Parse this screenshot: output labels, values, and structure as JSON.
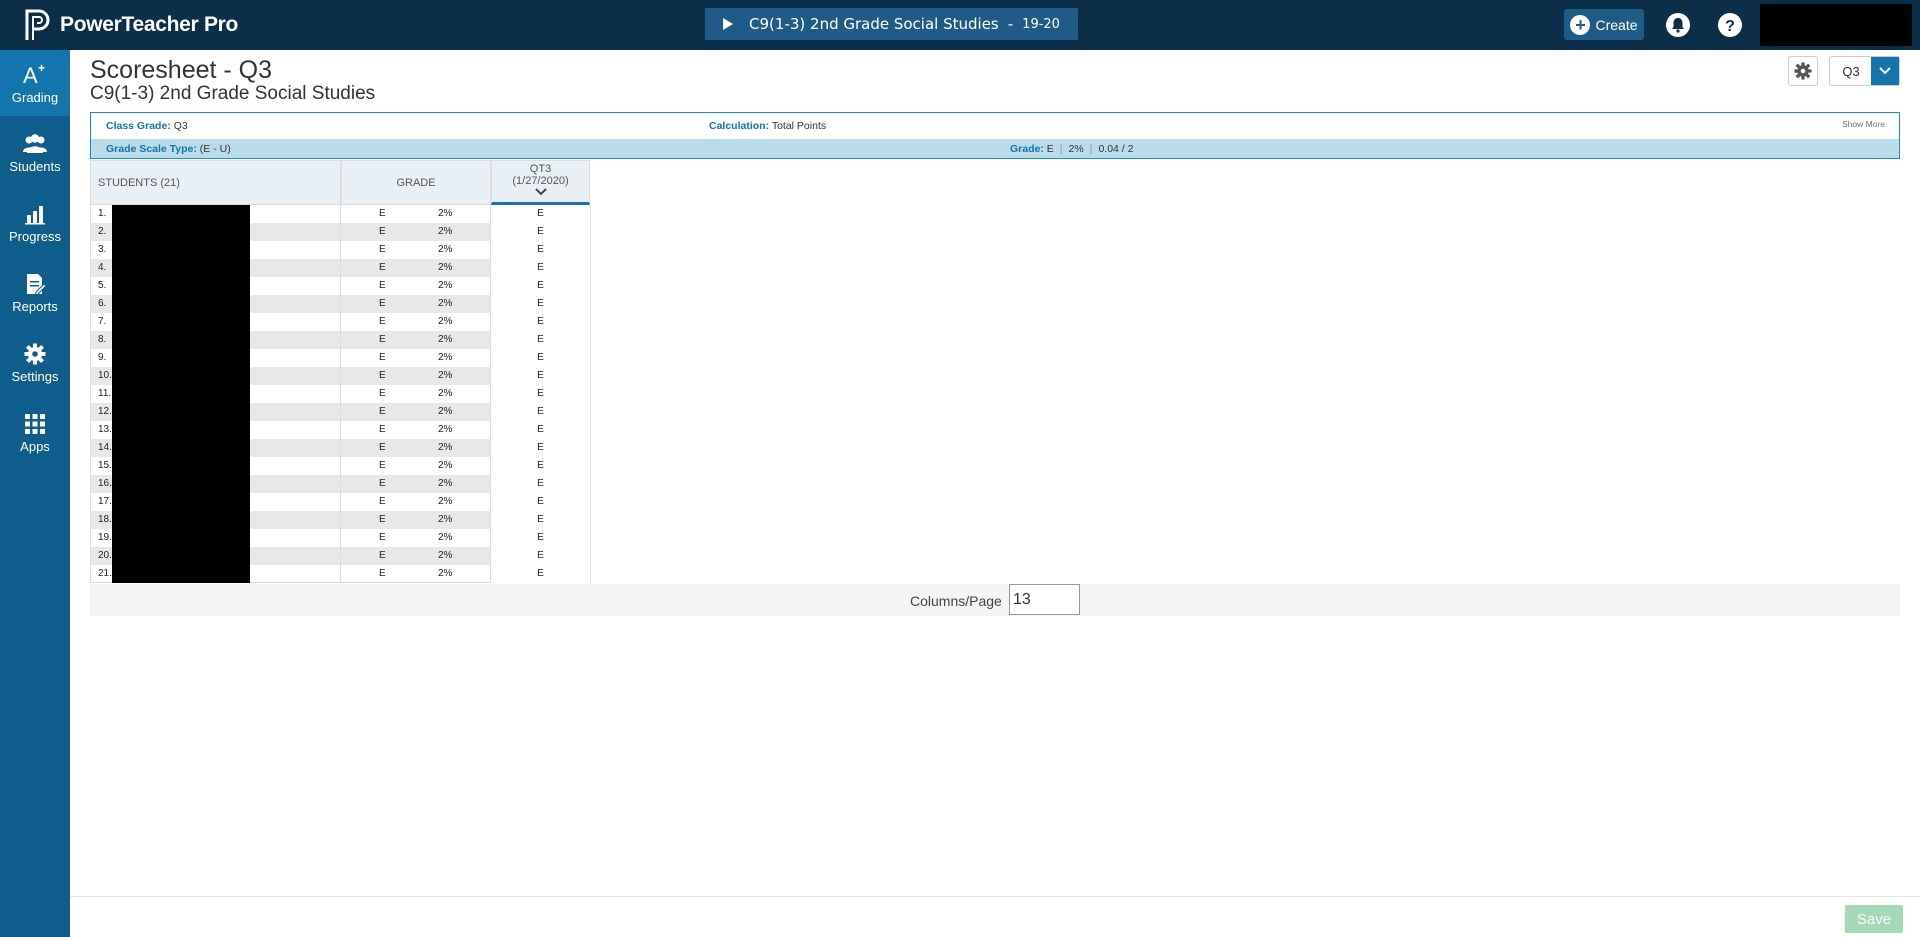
{
  "app": {
    "name": "PowerTeacher Pro"
  },
  "header": {
    "class_name": "C9(1-3) 2nd Grade Social Studies",
    "separator": "-",
    "year": "19-20",
    "create_label": "Create",
    "help_label": "?"
  },
  "nav": [
    {
      "label": "Grading",
      "icon": "grading-icon"
    },
    {
      "label": "Students",
      "icon": "students-icon"
    },
    {
      "label": "Progress",
      "icon": "progress-icon"
    },
    {
      "label": "Reports",
      "icon": "reports-icon"
    },
    {
      "label": "Settings",
      "icon": "settings-icon"
    },
    {
      "label": "Apps",
      "icon": "apps-icon"
    }
  ],
  "page": {
    "title": "Scoresheet - Q3",
    "subtitle": "C9(1-3) 2nd Grade Social Studies",
    "term": "Q3"
  },
  "info": {
    "class_grade_label": "Class Grade:",
    "class_grade_value": "Q3",
    "calculation_label": "Calculation:",
    "calculation_value": "Total Points",
    "show_more": "Show More",
    "grade_scale_label": "Grade Scale Type:",
    "grade_scale_value": "(E - U)",
    "grade_label": "Grade:",
    "grade_value": "E",
    "grade_percent": "2%",
    "grade_points": "0.04 / 2"
  },
  "table": {
    "students_header": "STUDENTS (21)",
    "grade_header": "GRADE",
    "assignment_name": "QT3",
    "assignment_date": "(1/27/2020)",
    "rows": [
      {
        "num": "1.",
        "grade": "E",
        "pct": "2%",
        "score": "E"
      },
      {
        "num": "2.",
        "grade": "E",
        "pct": "2%",
        "score": "E"
      },
      {
        "num": "3.",
        "grade": "E",
        "pct": "2%",
        "score": "E"
      },
      {
        "num": "4.",
        "grade": "E",
        "pct": "2%",
        "score": "E"
      },
      {
        "num": "5.",
        "grade": "E",
        "pct": "2%",
        "score": "E"
      },
      {
        "num": "6.",
        "grade": "E",
        "pct": "2%",
        "score": "E"
      },
      {
        "num": "7.",
        "grade": "E",
        "pct": "2%",
        "score": "E"
      },
      {
        "num": "8.",
        "grade": "E",
        "pct": "2%",
        "score": "E"
      },
      {
        "num": "9.",
        "grade": "E",
        "pct": "2%",
        "score": "E"
      },
      {
        "num": "10.",
        "grade": "E",
        "pct": "2%",
        "score": "E"
      },
      {
        "num": "11.",
        "grade": "E",
        "pct": "2%",
        "score": "E"
      },
      {
        "num": "12.",
        "grade": "E",
        "pct": "2%",
        "score": "E"
      },
      {
        "num": "13.",
        "grade": "E",
        "pct": "2%",
        "score": "E"
      },
      {
        "num": "14.",
        "grade": "E",
        "pct": "2%",
        "score": "E"
      },
      {
        "num": "15.",
        "grade": "E",
        "pct": "2%",
        "score": "E"
      },
      {
        "num": "16.",
        "grade": "E",
        "pct": "2%",
        "score": "E"
      },
      {
        "num": "17.",
        "grade": "E",
        "pct": "2%",
        "score": "E"
      },
      {
        "num": "18.",
        "grade": "E",
        "pct": "2%",
        "score": "E"
      },
      {
        "num": "19.",
        "grade": "E",
        "pct": "2%",
        "score": "E"
      },
      {
        "num": "20.",
        "grade": "E",
        "pct": "2%",
        "score": "E"
      },
      {
        "num": "21.",
        "grade": "E",
        "pct": "2%",
        "score": "E"
      }
    ]
  },
  "pager": {
    "label": "Columns/Page",
    "value": "13"
  },
  "footer": {
    "save_label": "Save"
  },
  "colors": {
    "topbar": "#0c2f49",
    "sidenav": "#0e5d8a",
    "accent": "#1475ac",
    "save": "#a3d9b4"
  }
}
